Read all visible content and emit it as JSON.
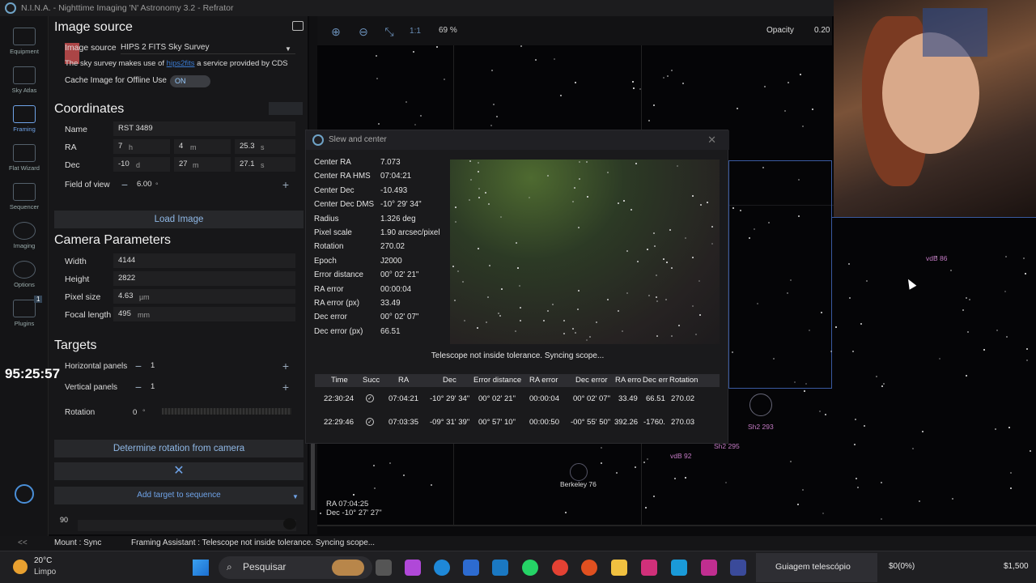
{
  "window": {
    "title": "N.I.N.A. - Nighttime Imaging 'N' Astronomy 3.2   -   Refrator"
  },
  "nav": [
    {
      "label": "Equipment",
      "icon": "telescope-icon"
    },
    {
      "label": "Sky Atlas",
      "icon": "map-icon"
    },
    {
      "label": "Framing",
      "icon": "framing-icon"
    },
    {
      "label": "Flat Wizard",
      "icon": "wizard-icon"
    },
    {
      "label": "Sequencer",
      "icon": "list-icon"
    },
    {
      "label": "Imaging",
      "icon": "camera-icon"
    },
    {
      "label": "Options",
      "icon": "gear-icon"
    },
    {
      "label": "Plugins",
      "icon": "puzzle-icon",
      "badge": "1"
    }
  ],
  "image_source": {
    "title": "Image source",
    "label": "Image source",
    "value": "HIPS 2 FITS Sky Survey",
    "note_pre": "The sky survey makes use of ",
    "note_link": "hips2fits",
    "note_post": " a service provided by CDS",
    "cache_label": "Cache Image for Offline Use",
    "cache_state": "ON"
  },
  "coordinates": {
    "title": "Coordinates",
    "name_label": "Name",
    "name": "RST 3489",
    "ra_label": "RA",
    "ra_h": "7",
    "ra_m": "4",
    "ra_s": "25.3",
    "dec_label": "Dec",
    "dec_d": "-10",
    "dec_m": "27",
    "dec_s": "27.1",
    "fov_label": "Field of view",
    "fov": "6.00",
    "u_h": "h",
    "u_m": "m",
    "u_s": "s",
    "u_d": "d",
    "u_deg": "°"
  },
  "load_image": "Load Image",
  "camera": {
    "title": "Camera Parameters",
    "width_label": "Width",
    "width": "4144",
    "height_label": "Height",
    "height": "2822",
    "pixel_label": "Pixel size",
    "pixel": "4.63",
    "pixel_unit": "µm",
    "focal_label": "Focal length",
    "focal": "495",
    "focal_unit": "mm"
  },
  "targets": {
    "title": "Targets",
    "h_label": "Horizontal panels",
    "h": "1",
    "v_label": "Vertical panels",
    "v": "1",
    "rot_label": "Rotation",
    "rot": "0",
    "rot_unit": "°"
  },
  "determine_rotation": "Determine rotation from camera",
  "add_target": "Add target to sequence",
  "small_value": "90",
  "timer": "95:25:57",
  "skyview": {
    "zoom_fit": "1:1",
    "zoom": "69 %",
    "opacity_label": "Opacity",
    "opacity": "0.20",
    "ra_readout": "RA  07:04:25",
    "dec_readout": "Dec -10° 27' 27\"",
    "objects": [
      "vdB 86",
      "Sh2 293",
      "Sh2 295",
      "vdB 92",
      "Berkeley 76"
    ]
  },
  "dialog": {
    "title": "Slew and center",
    "rows": [
      [
        "Center RA",
        "7.073"
      ],
      [
        "Center RA HMS",
        "07:04:21"
      ],
      [
        "Center Dec",
        "-10.493"
      ],
      [
        "Center Dec DMS",
        "-10° 29' 34\""
      ],
      [
        "Radius",
        "1.326 deg"
      ],
      [
        "Pixel scale",
        "1.90 arcsec/pixel"
      ],
      [
        "Rotation",
        "270.02"
      ],
      [
        "Epoch",
        "J2000"
      ],
      [
        "Error distance",
        "00° 02' 21\""
      ],
      [
        "RA error",
        "00:00:04"
      ],
      [
        "RA error (px)",
        "33.49"
      ],
      [
        "Dec error",
        "00° 02' 07\""
      ],
      [
        "Dec error (px)",
        "66.51"
      ]
    ],
    "status": "Telescope not inside tolerance. Syncing scope...",
    "columns": [
      "Time",
      "Succ",
      "RA",
      "Dec",
      "Error distance",
      "RA error",
      "Dec error",
      "RA erro",
      "Dec err",
      "Rotation"
    ],
    "table": [
      [
        "22:30:24",
        "✓",
        "07:04:21",
        "-10° 29' 34\"",
        "00° 02' 21\"",
        "00:00:04",
        "00° 02' 07\"",
        "33.49",
        "66.51",
        "270.02"
      ],
      [
        "22:29:46",
        "✓",
        "07:03:35",
        "-09° 31' 39\"",
        "00° 57' 10\"",
        "00:00:50",
        "-00° 55' 50\"",
        "392.26",
        "-1760.",
        "270.03"
      ]
    ]
  },
  "statusbar": {
    "mount": "Mount :  Sync",
    "framing": "Framing Assistant :  Telescope not inside tolerance. Syncing scope..."
  },
  "taskbar": {
    "temp": "20°C",
    "weather": "Limpo",
    "search": "Pesquisar",
    "app_label": "Guiagem telescópio",
    "percent": "$0(0%)",
    "price": "$1,500"
  }
}
